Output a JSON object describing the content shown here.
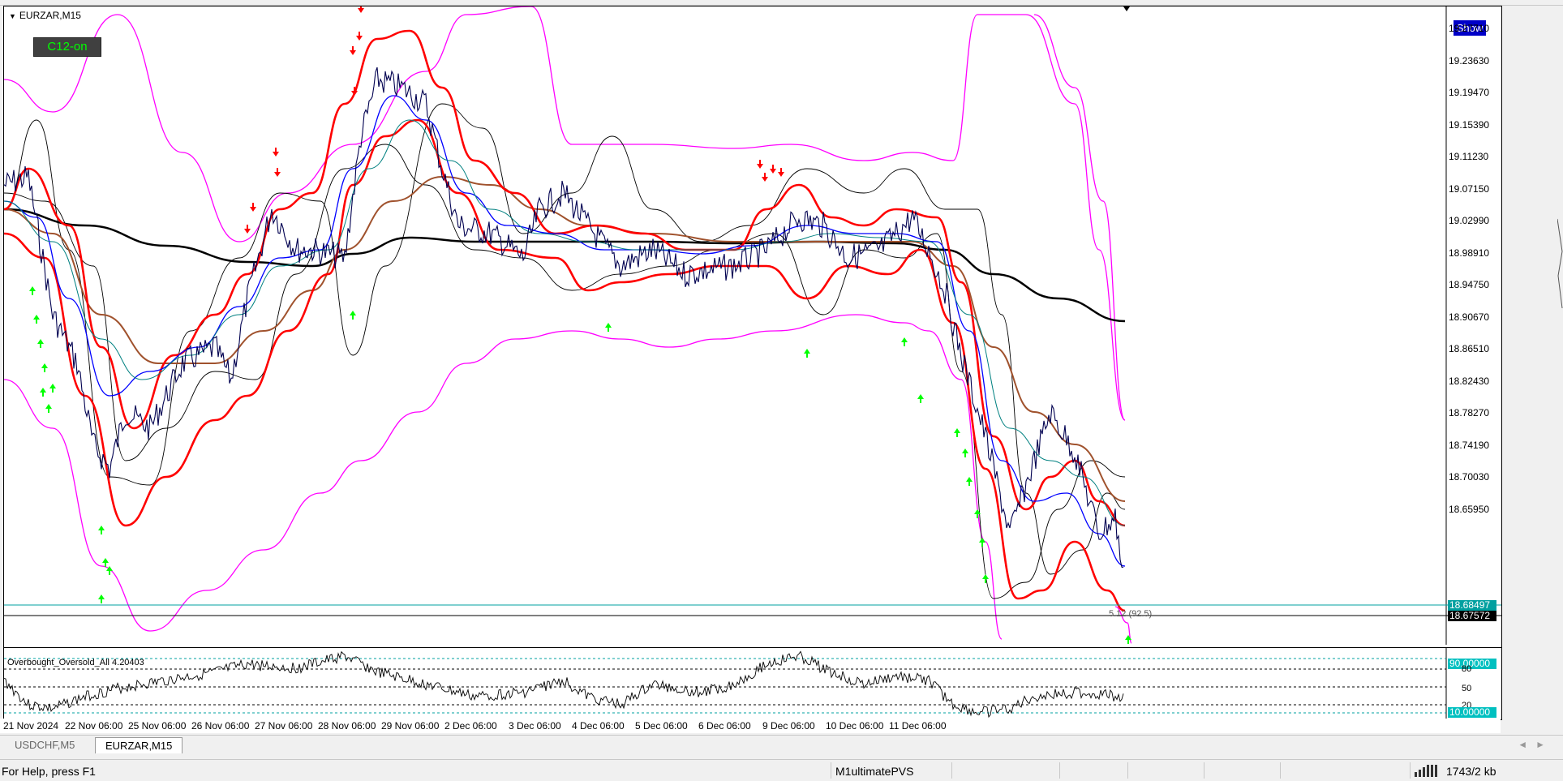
{
  "chart": {
    "symbol_title": "EURZAR,M15",
    "c12_label": "C12-on",
    "show_button": "Show",
    "price_axis": [
      "19.27710",
      "19.23630",
      "19.19470",
      "19.15390",
      "19.11230",
      "19.07150",
      "19.02990",
      "18.98910",
      "18.94750",
      "18.90670",
      "18.86510",
      "18.82430",
      "18.78270",
      "18.74190",
      "18.70030",
      "18.65950"
    ],
    "bid_tag": "18.68497",
    "ask_tag": "18.67572",
    "distance_label": "5.12 (92.5)",
    "time_axis": [
      "21 Nov 2024",
      "22 Nov 06:00",
      "25 Nov 06:00",
      "26 Nov 06:00",
      "27 Nov 06:00",
      "28 Nov 06:00",
      "29 Nov 06:00",
      "2 Dec 06:00",
      "3 Dec 06:00",
      "4 Dec 06:00",
      "5 Dec 06:00",
      "6 Dec 06:00",
      "9 Dec 06:00",
      "10 Dec 06:00",
      "11 Dec 06:00"
    ]
  },
  "sub_indicator": {
    "title": "Overbought_Oversold_All 4.20403",
    "level_80": "80",
    "level_50": "50",
    "level_20": "20",
    "tag_high": "90.00000",
    "tag_low": "10.00000"
  },
  "tabs": [
    {
      "label": "USDCHF,M5",
      "active": false
    },
    {
      "label": "EURZAR,M15",
      "active": true
    }
  ],
  "status_bar": {
    "help_text": "For Help, press F1",
    "profile": "M1ultimatePVS",
    "traffic": "1743/2 kb"
  },
  "colors": {
    "envelope_magenta": "#ff00ff",
    "band_red": "#ff0000",
    "ma_black": "#000000",
    "ma_brown": "#a0522d",
    "price_navy": "#000050",
    "ma_blue": "#0000ff",
    "ma_teal": "#008080",
    "arrow_green": "#00ff00",
    "arrow_red": "#ff0000",
    "show_blue": "#0000c8",
    "tag_cyan": "#00a0a0"
  }
}
